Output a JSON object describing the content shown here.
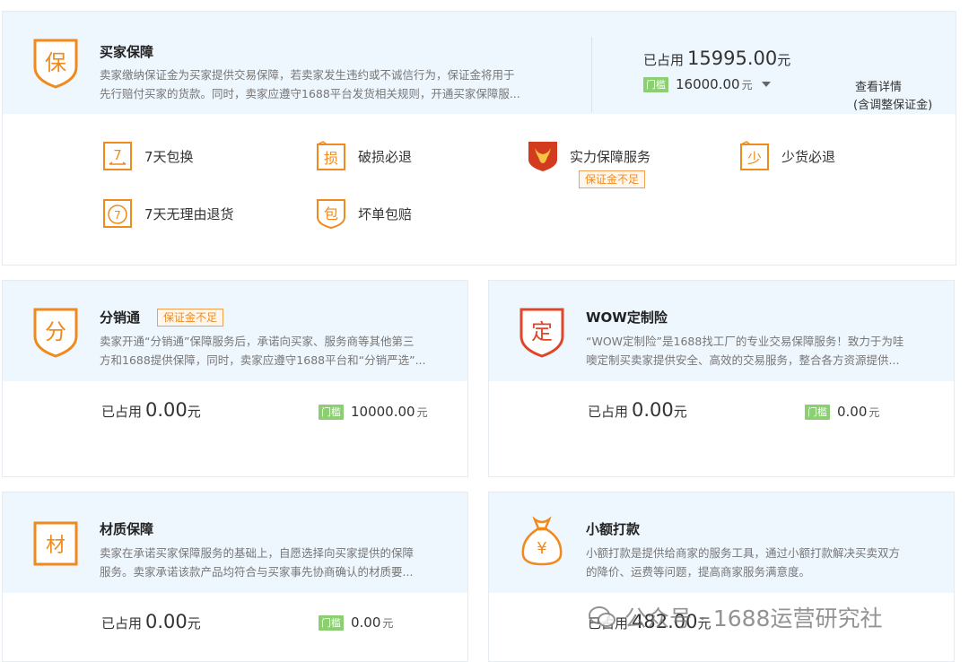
{
  "colors": {
    "accent": "#f08a1c",
    "threshold_green": "#8ccf73",
    "header_bg": "#eef6fe"
  },
  "buyer_protection": {
    "icon_char": "保",
    "title": "买家保障",
    "desc_line1": "卖家缴纳保证金为买家提供交易保障，若卖家发生违约或不诚信行为，保证金将用于",
    "desc_line2": "先行赔付买家的货款。同时，卖家应遵守1688平台发货相关规则，开通买家保障服...",
    "occupied_label": "已占用",
    "occupied_value": "15995.00",
    "unit": "元",
    "threshold_tag": "门槛",
    "threshold_value": "16000.00",
    "detail_link": "查看详情",
    "detail_sub": "(含调整保证金)",
    "services": [
      {
        "icon": "7-days-exchange-icon",
        "icon_char": "7",
        "label": "7天包换"
      },
      {
        "icon": "damage-refund-icon",
        "icon_char": "损",
        "label": "破损必退"
      },
      {
        "icon": "strength-guarantee-icon",
        "icon_char": "",
        "label": "实力保障服务",
        "warning": "保证金不足"
      },
      {
        "icon": "missing-goods-refund-icon",
        "icon_char": "少",
        "label": "少货必退"
      },
      {
        "icon": "7-days-return-icon",
        "icon_char": "7",
        "label": "7天无理由退货"
      },
      {
        "icon": "bad-order-compensation-icon",
        "icon_char": "包",
        "label": "坏单包赔"
      }
    ]
  },
  "distribution": {
    "icon_char": "分",
    "title": "分销通",
    "warning": "保证金不足",
    "desc_line1": "卖家开通“分销通”保障服务后，承诺向买家、服务商等其他第三",
    "desc_line2": "方和1688提供保障，同时，卖家应遵守1688平台和“分销严选”...",
    "occupied_label": "已占用",
    "occupied_value": "0.00",
    "unit": "元",
    "threshold_tag": "门槛",
    "threshold_value": "10000.00"
  },
  "wow_insurance": {
    "icon_char": "定",
    "title": "WOW定制险",
    "desc_line1": "“WOW定制险”是1688找工厂的专业交易保障服务！致力于为哇",
    "desc_line2": "噢定制买卖家提供安全、高效的交易服务，整合各方资源提供...",
    "occupied_label": "已占用",
    "occupied_value": "0.00",
    "unit": "元",
    "threshold_tag": "门槛",
    "threshold_value": "0.00"
  },
  "material_guarantee": {
    "icon_char": "材",
    "title": "材质保障",
    "desc_line1": "卖家在承诺买家保障服务的基础上，自愿选择向买家提供的保障",
    "desc_line2": "服务。卖家承诺该款产品均符合与买家事先协商确认的材质要...",
    "occupied_label": "已占用",
    "occupied_value": "0.00",
    "unit": "元",
    "threshold_tag": "门槛",
    "threshold_value": "0.00"
  },
  "small_payment": {
    "icon_char": "¥",
    "title": "小额打款",
    "desc_line1": "小额打款是提供给商家的服务工具，通过小额打款解决买卖双方",
    "desc_line2": "的降价、运费等问题，提高商家服务满意度。",
    "occupied_label": "已占用",
    "occupied_value": "482.00",
    "unit": "元"
  },
  "watermark": "公众号 · 1688运营研究社"
}
